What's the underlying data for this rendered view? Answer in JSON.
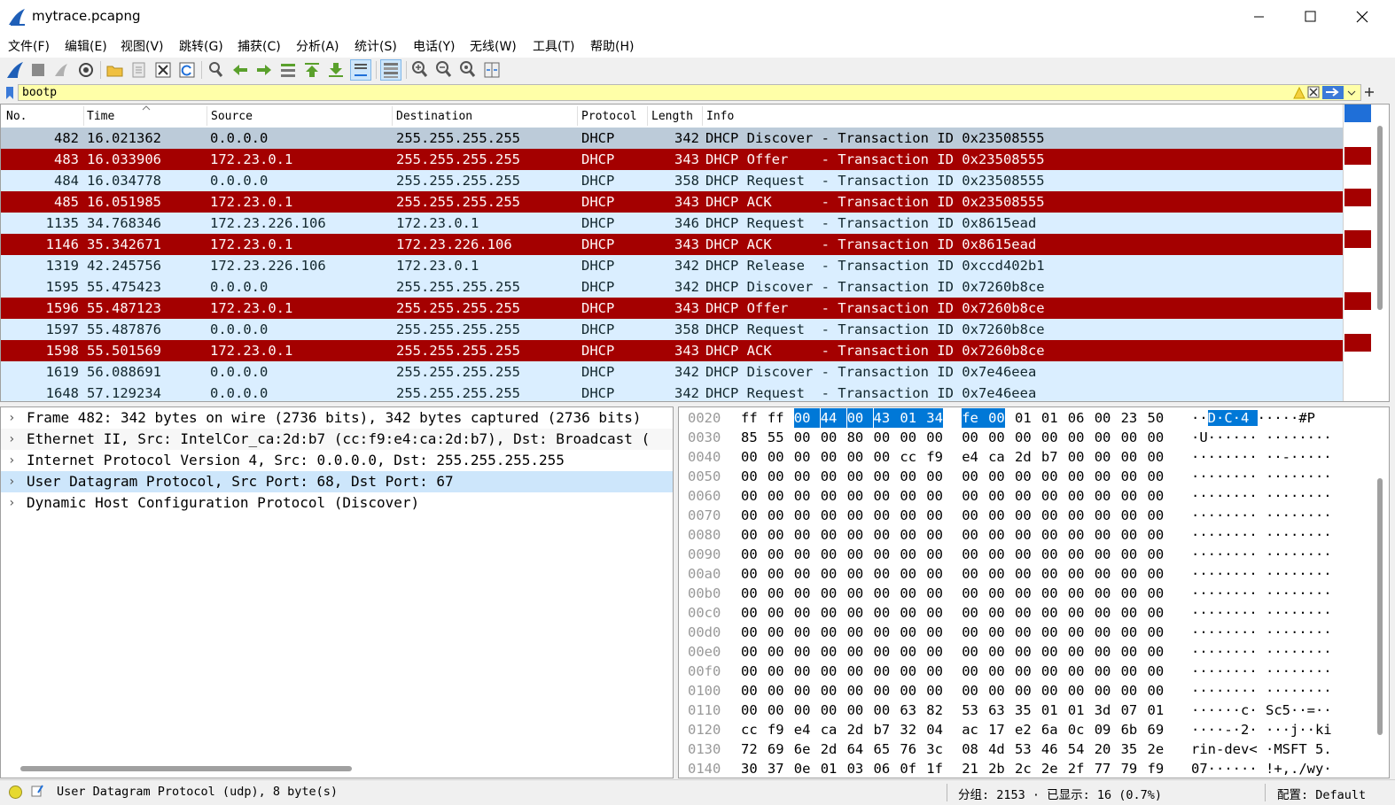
{
  "window": {
    "title": "mytrace.pcapng"
  },
  "menu": [
    "文件(F)",
    "编辑(E)",
    "视图(V)",
    "跳转(G)",
    "捕获(C)",
    "分析(A)",
    "统计(S)",
    "电话(Y)",
    "无线(W)",
    "工具(T)",
    "帮助(H)"
  ],
  "toolbar": {
    "icons": [
      "shark-fin-start-icon",
      "stop-capture-icon",
      "restart-capture-icon",
      "capture-options-icon",
      "open-file-icon",
      "save-file-icon",
      "close-file-icon",
      "reload-file-icon",
      "find-packet-icon",
      "go-back-icon",
      "go-forward-icon",
      "go-to-packet-icon",
      "first-packet-icon",
      "last-packet-icon",
      "auto-scroll-icon",
      "colorize-icon",
      "zoom-in-icon",
      "zoom-out-icon",
      "zoom-normal-icon",
      "resize-columns-icon"
    ]
  },
  "filter": {
    "value": "bootp"
  },
  "columns": [
    "No.",
    "Time",
    "Source",
    "Destination",
    "Protocol",
    "Length",
    "Info"
  ],
  "packets": [
    {
      "no": "482",
      "time": "16.021362",
      "src": "0.0.0.0",
      "dst": "255.255.255.255",
      "proto": "DHCP",
      "len": "342",
      "info": "DHCP Discover - Transaction ID 0x23508555",
      "style": "selected"
    },
    {
      "no": "483",
      "time": "16.033906",
      "src": "172.23.0.1",
      "dst": "255.255.255.255",
      "proto": "DHCP",
      "len": "343",
      "info": "DHCP Offer    - Transaction ID 0x23508555",
      "style": "red"
    },
    {
      "no": "484",
      "time": "16.034778",
      "src": "0.0.0.0",
      "dst": "255.255.255.255",
      "proto": "DHCP",
      "len": "358",
      "info": "DHCP Request  - Transaction ID 0x23508555",
      "style": "blue"
    },
    {
      "no": "485",
      "time": "16.051985",
      "src": "172.23.0.1",
      "dst": "255.255.255.255",
      "proto": "DHCP",
      "len": "343",
      "info": "DHCP ACK      - Transaction ID 0x23508555",
      "style": "red"
    },
    {
      "no": "1135",
      "time": "34.768346",
      "src": "172.23.226.106",
      "dst": "172.23.0.1",
      "proto": "DHCP",
      "len": "346",
      "info": "DHCP Request  - Transaction ID 0x8615ead",
      "style": "blue"
    },
    {
      "no": "1146",
      "time": "35.342671",
      "src": "172.23.0.1",
      "dst": "172.23.226.106",
      "proto": "DHCP",
      "len": "343",
      "info": "DHCP ACK      - Transaction ID 0x8615ead",
      "style": "red"
    },
    {
      "no": "1319",
      "time": "42.245756",
      "src": "172.23.226.106",
      "dst": "172.23.0.1",
      "proto": "DHCP",
      "len": "342",
      "info": "DHCP Release  - Transaction ID 0xccd402b1",
      "style": "blue"
    },
    {
      "no": "1595",
      "time": "55.475423",
      "src": "0.0.0.0",
      "dst": "255.255.255.255",
      "proto": "DHCP",
      "len": "342",
      "info": "DHCP Discover - Transaction ID 0x7260b8ce",
      "style": "blue"
    },
    {
      "no": "1596",
      "time": "55.487123",
      "src": "172.23.0.1",
      "dst": "255.255.255.255",
      "proto": "DHCP",
      "len": "343",
      "info": "DHCP Offer    - Transaction ID 0x7260b8ce",
      "style": "red"
    },
    {
      "no": "1597",
      "time": "55.487876",
      "src": "0.0.0.0",
      "dst": "255.255.255.255",
      "proto": "DHCP",
      "len": "358",
      "info": "DHCP Request  - Transaction ID 0x7260b8ce",
      "style": "blue"
    },
    {
      "no": "1598",
      "time": "55.501569",
      "src": "172.23.0.1",
      "dst": "255.255.255.255",
      "proto": "DHCP",
      "len": "343",
      "info": "DHCP ACK      - Transaction ID 0x7260b8ce",
      "style": "red"
    },
    {
      "no": "1619",
      "time": "56.088691",
      "src": "0.0.0.0",
      "dst": "255.255.255.255",
      "proto": "DHCP",
      "len": "342",
      "info": "DHCP Discover - Transaction ID 0x7e46eea",
      "style": "blue"
    },
    {
      "no": "1648",
      "time": "57.129234",
      "src": "0.0.0.0",
      "dst": "255.255.255.255",
      "proto": "DHCP",
      "len": "342",
      "info": "DHCP Request  - Transaction ID 0x7e46eea",
      "style": "blue"
    }
  ],
  "details": [
    {
      "text": "Frame 482: 342 bytes on wire (2736 bits), 342 bytes captured (2736 bits)",
      "selected": false
    },
    {
      "text": "Ethernet II, Src: IntelCor_ca:2d:b7 (cc:f9:e4:ca:2d:b7), Dst: Broadcast (",
      "selected": false
    },
    {
      "text": "Internet Protocol Version 4, Src: 0.0.0.0, Dst: 255.255.255.255",
      "selected": false
    },
    {
      "text": "User Datagram Protocol, Src Port: 68, Dst Port: 67",
      "selected": true
    },
    {
      "text": "Dynamic Host Configuration Protocol (Discover)",
      "selected": false
    }
  ],
  "bytes": [
    {
      "off": "0020",
      "hex": [
        "ff",
        "ff",
        "00",
        "44",
        "00",
        "43",
        "01",
        "34",
        "fe",
        "00",
        "01",
        "01",
        "06",
        "00",
        "23",
        "50"
      ],
      "ascii": "··D·C·4 ·····#P",
      "hl": [
        2,
        9
      ],
      "hla": [
        2,
        9
      ]
    },
    {
      "off": "0030",
      "hex": [
        "85",
        "55",
        "00",
        "00",
        "80",
        "00",
        "00",
        "00",
        "00",
        "00",
        "00",
        "00",
        "00",
        "00",
        "00",
        "00"
      ],
      "ascii": "·U······ ········"
    },
    {
      "off": "0040",
      "hex": [
        "00",
        "00",
        "00",
        "00",
        "00",
        "00",
        "cc",
        "f9",
        "e4",
        "ca",
        "2d",
        "b7",
        "00",
        "00",
        "00",
        "00"
      ],
      "ascii": "········ ··-·····"
    },
    {
      "off": "0050",
      "hex": [
        "00",
        "00",
        "00",
        "00",
        "00",
        "00",
        "00",
        "00",
        "00",
        "00",
        "00",
        "00",
        "00",
        "00",
        "00",
        "00"
      ],
      "ascii": "········ ········"
    },
    {
      "off": "0060",
      "hex": [
        "00",
        "00",
        "00",
        "00",
        "00",
        "00",
        "00",
        "00",
        "00",
        "00",
        "00",
        "00",
        "00",
        "00",
        "00",
        "00"
      ],
      "ascii": "········ ········"
    },
    {
      "off": "0070",
      "hex": [
        "00",
        "00",
        "00",
        "00",
        "00",
        "00",
        "00",
        "00",
        "00",
        "00",
        "00",
        "00",
        "00",
        "00",
        "00",
        "00"
      ],
      "ascii": "········ ········"
    },
    {
      "off": "0080",
      "hex": [
        "00",
        "00",
        "00",
        "00",
        "00",
        "00",
        "00",
        "00",
        "00",
        "00",
        "00",
        "00",
        "00",
        "00",
        "00",
        "00"
      ],
      "ascii": "········ ········"
    },
    {
      "off": "0090",
      "hex": [
        "00",
        "00",
        "00",
        "00",
        "00",
        "00",
        "00",
        "00",
        "00",
        "00",
        "00",
        "00",
        "00",
        "00",
        "00",
        "00"
      ],
      "ascii": "········ ········"
    },
    {
      "off": "00a0",
      "hex": [
        "00",
        "00",
        "00",
        "00",
        "00",
        "00",
        "00",
        "00",
        "00",
        "00",
        "00",
        "00",
        "00",
        "00",
        "00",
        "00"
      ],
      "ascii": "········ ········"
    },
    {
      "off": "00b0",
      "hex": [
        "00",
        "00",
        "00",
        "00",
        "00",
        "00",
        "00",
        "00",
        "00",
        "00",
        "00",
        "00",
        "00",
        "00",
        "00",
        "00"
      ],
      "ascii": "········ ········"
    },
    {
      "off": "00c0",
      "hex": [
        "00",
        "00",
        "00",
        "00",
        "00",
        "00",
        "00",
        "00",
        "00",
        "00",
        "00",
        "00",
        "00",
        "00",
        "00",
        "00"
      ],
      "ascii": "········ ········"
    },
    {
      "off": "00d0",
      "hex": [
        "00",
        "00",
        "00",
        "00",
        "00",
        "00",
        "00",
        "00",
        "00",
        "00",
        "00",
        "00",
        "00",
        "00",
        "00",
        "00"
      ],
      "ascii": "········ ········"
    },
    {
      "off": "00e0",
      "hex": [
        "00",
        "00",
        "00",
        "00",
        "00",
        "00",
        "00",
        "00",
        "00",
        "00",
        "00",
        "00",
        "00",
        "00",
        "00",
        "00"
      ],
      "ascii": "········ ········"
    },
    {
      "off": "00f0",
      "hex": [
        "00",
        "00",
        "00",
        "00",
        "00",
        "00",
        "00",
        "00",
        "00",
        "00",
        "00",
        "00",
        "00",
        "00",
        "00",
        "00"
      ],
      "ascii": "········ ········"
    },
    {
      "off": "0100",
      "hex": [
        "00",
        "00",
        "00",
        "00",
        "00",
        "00",
        "00",
        "00",
        "00",
        "00",
        "00",
        "00",
        "00",
        "00",
        "00",
        "00"
      ],
      "ascii": "········ ········"
    },
    {
      "off": "0110",
      "hex": [
        "00",
        "00",
        "00",
        "00",
        "00",
        "00",
        "63",
        "82",
        "53",
        "63",
        "35",
        "01",
        "01",
        "3d",
        "07",
        "01"
      ],
      "ascii": "······c· Sc5··=··"
    },
    {
      "off": "0120",
      "hex": [
        "cc",
        "f9",
        "e4",
        "ca",
        "2d",
        "b7",
        "32",
        "04",
        "ac",
        "17",
        "e2",
        "6a",
        "0c",
        "09",
        "6b",
        "69"
      ],
      "ascii": "····-·2· ···j··ki"
    },
    {
      "off": "0130",
      "hex": [
        "72",
        "69",
        "6e",
        "2d",
        "64",
        "65",
        "76",
        "3c",
        "08",
        "4d",
        "53",
        "46",
        "54",
        "20",
        "35",
        "2e"
      ],
      "ascii": "rin-dev< ·MSFT 5."
    },
    {
      "off": "0140",
      "hex": [
        "30",
        "37",
        "0e",
        "01",
        "03",
        "06",
        "0f",
        "1f",
        "21",
        "2b",
        "2c",
        "2e",
        "2f",
        "77",
        "79",
        "f9"
      ],
      "ascii": "07······ !+,./wy·"
    }
  ],
  "status": {
    "text": "User Datagram Protocol (udp), 8 byte(s)",
    "packets": "分组: 2153 · 已显示: 16 (0.7%)",
    "profile": "配置: Default"
  },
  "colors": {
    "red_row": "#a40000",
    "red_text": "#fff8f8",
    "blue_row": "#daeeff",
    "selected_row": "#bccbd9",
    "hex_highlight": "#0078d7",
    "filter_bg": "#ffffa8"
  }
}
